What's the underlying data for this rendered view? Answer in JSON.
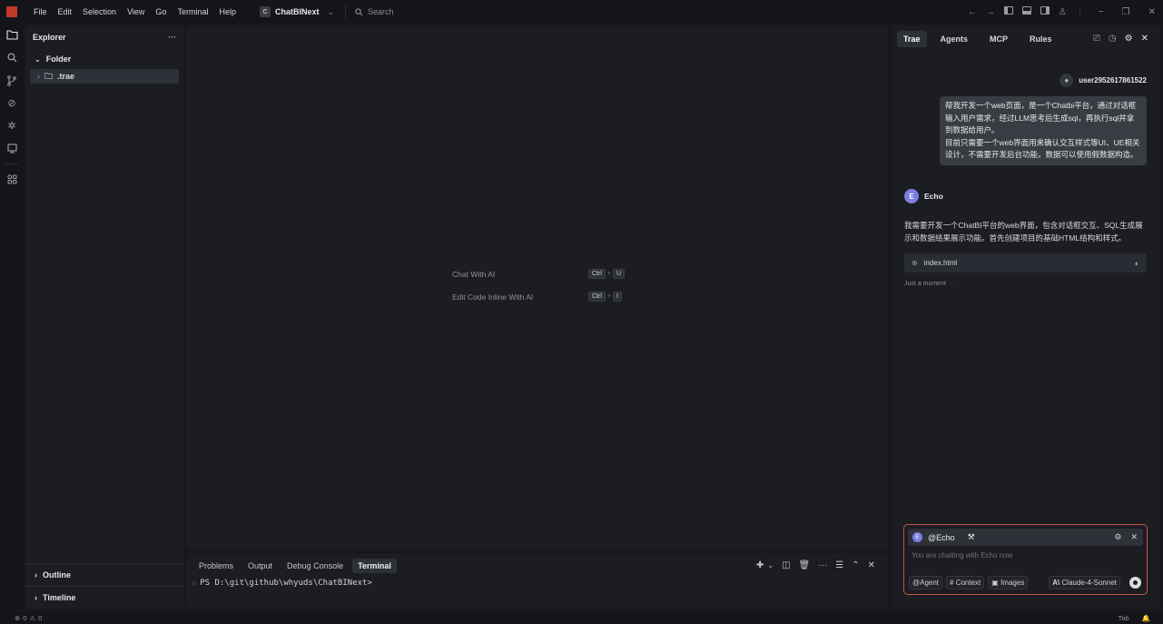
{
  "titlebar": {
    "menu": [
      "File",
      "Edit",
      "Selection",
      "View",
      "Go",
      "Terminal",
      "Help"
    ],
    "project_initial": "C",
    "project_name": "ChatBINext",
    "search_placeholder": "Search"
  },
  "explorer": {
    "title": "Explorer",
    "folder": "Folder",
    "items": [
      ".trae"
    ],
    "sections": [
      "Outline",
      "Timeline"
    ]
  },
  "editor": {
    "hints": [
      {
        "label": "Chat With AI",
        "keys": [
          "Ctrl",
          "U"
        ]
      },
      {
        "label": "Edit Code Inline With AI",
        "keys": [
          "Ctrl",
          "I"
        ]
      }
    ]
  },
  "panel": {
    "tabs": [
      "Problems",
      "Output",
      "Debug Console",
      "Terminal"
    ],
    "active_tab": "Terminal",
    "terminal_line": "PS D:\\git\\github\\whyuds\\ChatBINext>"
  },
  "chat": {
    "tabs": [
      "Trae",
      "Agents",
      "MCP",
      "Rules"
    ],
    "user_name": "user2952617861522",
    "user_message": [
      "帮我开发一个web页面，是一个Chatbi平台，通过对话框输入用户需求，经过LLM思考后生成sql，再执行sql并拿到数据给用户。",
      "目前只需要一个web界面用来确认交互样式等UI、UE相关设计，不需要开发后台功能，数据可以使用假数据构造。"
    ],
    "agent_initial": "E",
    "agent_name": "Echo",
    "agent_message": "我需要开发一个ChatBI平台的web界面，包含对话框交互、SQL生成展示和数据结果展示功能。首先创建项目的基础HTML结构和样式。",
    "file_card": "index.html",
    "status": "Just a moment",
    "input": {
      "agent_tag": "@Echo",
      "placeholder": "You are chatting with Echo now",
      "chips": [
        "@Agent",
        "# Context",
        "Images"
      ],
      "model": "Claude-4-Sonnet"
    }
  },
  "statusbar": {
    "errors": "0",
    "warnings": "0",
    "right": "Tab"
  },
  "colors": {
    "background": "#17181d",
    "panel": "#1c1d22",
    "input_border": "#c4574a",
    "agent_accent": "#7b7ee0"
  }
}
